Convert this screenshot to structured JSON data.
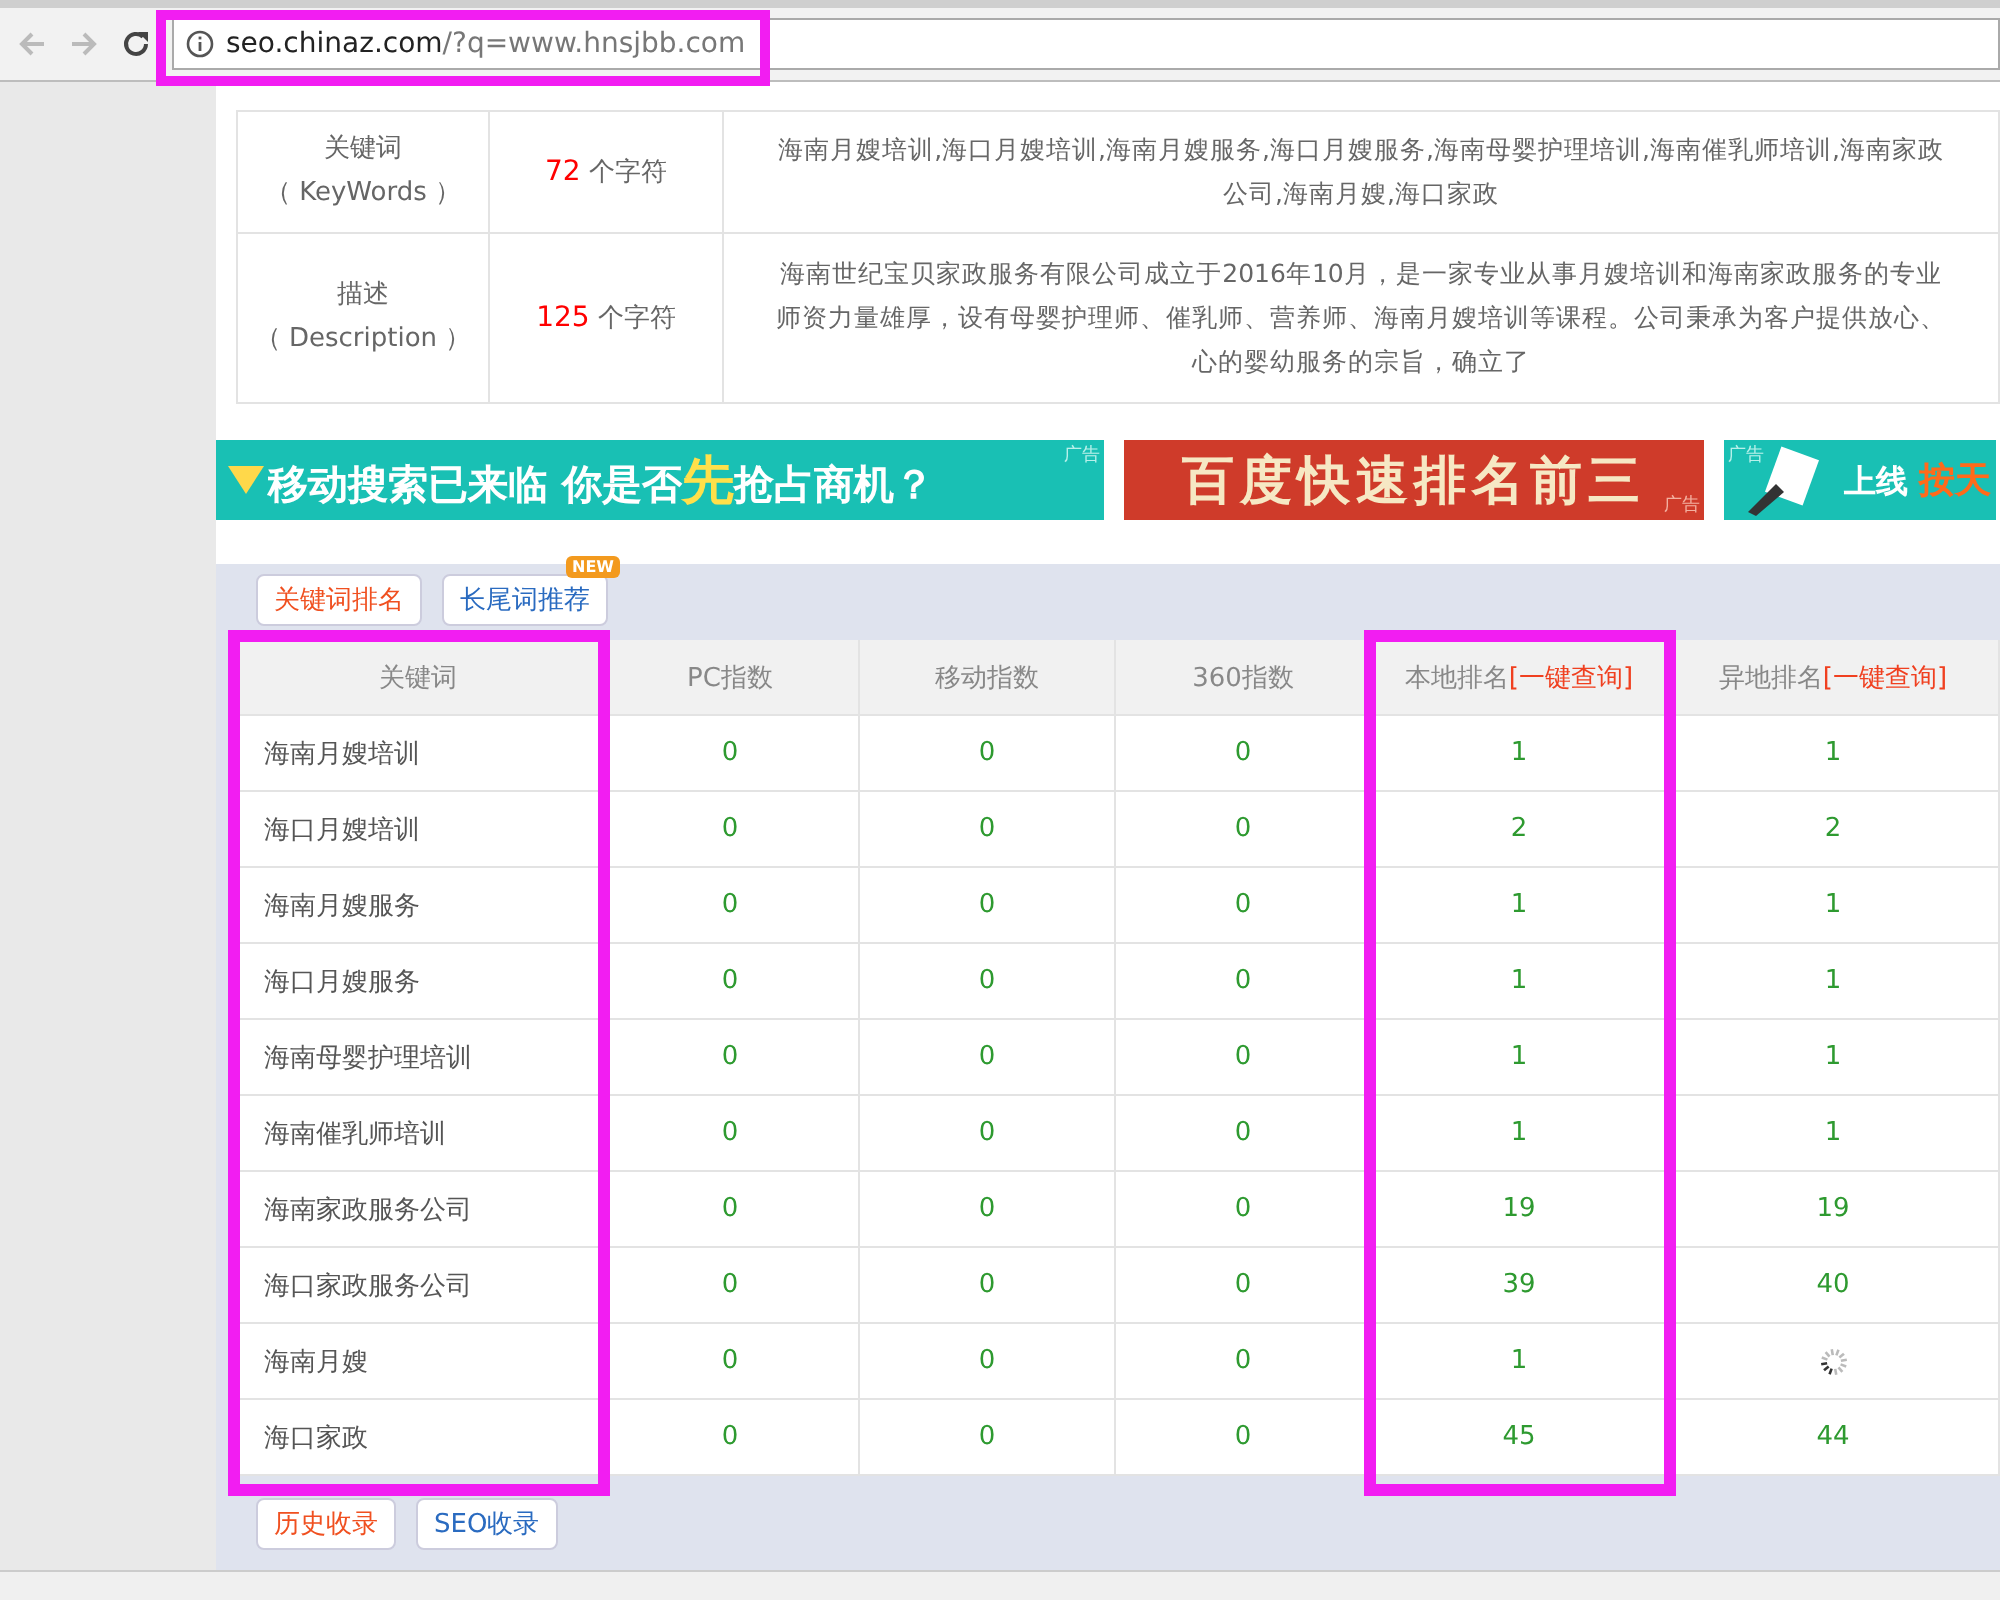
{
  "browser": {
    "address_bar": {
      "host": "seo.chinaz.com",
      "path": "/?q=www.hnsjbb.com",
      "highlighted": true
    }
  },
  "meta_rows": [
    {
      "label": "关键词",
      "sublabel": "（ KeyWords ）",
      "count": "72",
      "unit": "个字符",
      "lines": [
        "海南月嫂培训,海口月嫂培训,海南月嫂服务,海口月嫂服务,海南母婴护理培训,海南催乳师培训,海南家政",
        "公司,海南月嫂,海口家政"
      ]
    },
    {
      "label": "描述",
      "sublabel": "（ Description ）",
      "count": "125",
      "unit": "个字符",
      "lines": [
        "海南世纪宝贝家政服务有限公司成立于2016年10月，是一家专业从事月嫂培训和海南家政服务的专业",
        "师资力量雄厚，设有母婴护理师、催乳师、营养师、海南月嫂培训等课程。公司秉承为客户提供放心、",
        "心的婴幼服务的宗旨，确立了"
      ]
    }
  ],
  "banners": [
    {
      "kind": "teal",
      "text": "移动搜索已来临 你是否",
      "accent": "先",
      "text_after": "抢占商机？",
      "ad_label": "广告"
    },
    {
      "kind": "red",
      "text": "百度快速排名前三",
      "ad_label": "广告"
    },
    {
      "kind": "teal-cut",
      "text": "上线",
      "accent": "按天",
      "ad_label": "广告"
    }
  ],
  "rank_tabs": [
    {
      "label": "关键词排名",
      "selected": true
    },
    {
      "label": "长尾词推荐",
      "selected": false,
      "badge": "NEW"
    }
  ],
  "table": {
    "columns": [
      {
        "label": "关键词",
        "highlighted": true
      },
      {
        "label": "PC指数",
        "highlighted": false
      },
      {
        "label": "移动指数",
        "highlighted": false
      },
      {
        "label": "360指数",
        "highlighted": false
      },
      {
        "label": "本地排名",
        "link": "[一键查询]",
        "highlighted": true
      },
      {
        "label": "异地排名",
        "link": "[一键查询]",
        "highlighted": false
      }
    ],
    "rows": [
      {
        "keyword": "海南月嫂培训",
        "pc": "0",
        "mobile": "0",
        "i360": "0",
        "local": "1",
        "remote": "1",
        "loading": false
      },
      {
        "keyword": "海口月嫂培训",
        "pc": "0",
        "mobile": "0",
        "i360": "0",
        "local": "2",
        "remote": "2",
        "loading": false
      },
      {
        "keyword": "海南月嫂服务",
        "pc": "0",
        "mobile": "0",
        "i360": "0",
        "local": "1",
        "remote": "1",
        "loading": false
      },
      {
        "keyword": "海口月嫂服务",
        "pc": "0",
        "mobile": "0",
        "i360": "0",
        "local": "1",
        "remote": "1",
        "loading": false
      },
      {
        "keyword": "海南母婴护理培训",
        "pc": "0",
        "mobile": "0",
        "i360": "0",
        "local": "1",
        "remote": "1",
        "loading": false
      },
      {
        "keyword": "海南催乳师培训",
        "pc": "0",
        "mobile": "0",
        "i360": "0",
        "local": "1",
        "remote": "1",
        "loading": false
      },
      {
        "keyword": "海南家政服务公司",
        "pc": "0",
        "mobile": "0",
        "i360": "0",
        "local": "19",
        "remote": "19",
        "loading": false
      },
      {
        "keyword": "海口家政服务公司",
        "pc": "0",
        "mobile": "0",
        "i360": "0",
        "local": "39",
        "remote": "40",
        "loading": false
      },
      {
        "keyword": "海南月嫂",
        "pc": "0",
        "mobile": "0",
        "i360": "0",
        "local": "1",
        "loading": true
      },
      {
        "keyword": "海口家政",
        "pc": "0",
        "mobile": "0",
        "i360": "0",
        "local": "45",
        "remote": "44",
        "loading": false
      }
    ]
  },
  "bottom_tabs": [
    {
      "label": "历史收录",
      "selected": true
    },
    {
      "label": "SEO收录",
      "selected": false
    }
  ]
}
